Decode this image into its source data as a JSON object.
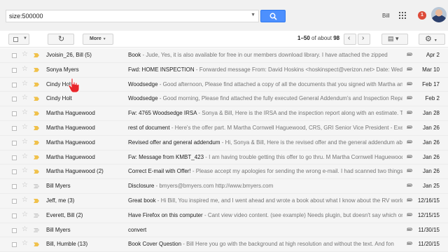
{
  "search": {
    "value": "size:500000"
  },
  "header": {
    "user_name": "Bill",
    "notification_count": "1"
  },
  "toolbar": {
    "more_label": "More",
    "pager": {
      "range": "1–50",
      "of_text": "of about",
      "total": "98"
    }
  },
  "icons": {
    "search": "search-icon",
    "apps": "apps-grid-icon",
    "refresh": "refresh-icon",
    "settings": "gear-icon",
    "star": "star-icon",
    "importance": "importance-marker-icon",
    "attachment": "paperclip-icon"
  },
  "colors": {
    "search_button": "#4d90fe",
    "notification": "#dd4b39",
    "important_marker": "#f0c14b"
  },
  "emails": [
    {
      "sender": "Jvoisin_26, Bill (5)",
      "subject": "Book",
      "snippet": " - Jude, Yes, it is also available for free in our members download library. I have attached the zipped",
      "date": "Apr 2",
      "important": true,
      "attachment": true
    },
    {
      "sender": "Sonya Myers",
      "subject": "Fwd: HOME INSPECTION",
      "snippet": " - Forwarded message From: David Hoskins <hoskinspect@verizon.net> Date: Wed",
      "date": "Mar 10",
      "important": true,
      "attachment": true
    },
    {
      "sender": "Cindy Holt",
      "subject": "Woodsedge",
      "snippet": " - Good afternoon, Please find attached a copy of all the documents that you signed with Martha and",
      "date": "Feb 17",
      "important": true,
      "attachment": true
    },
    {
      "sender": "Cindy Holt",
      "subject": "Woodsedge",
      "snippet": " - Good morning, Please find attached the fully executed General Addendum's and Inspection Repair",
      "date": "Feb 2",
      "important": true,
      "attachment": true
    },
    {
      "sender": "Martha Haguewood",
      "subject": "Fw: 4765 Woodsedge IRSA",
      "snippet": " - Sonya & Bill, Here is the IRSA and the inspection report along with an estimate. T",
      "date": "Jan 28",
      "important": true,
      "attachment": true
    },
    {
      "sender": "Martha Haguewood",
      "subject": "rest of document",
      "snippet": " - Here's the offer part. M Martha Cornwell Haguewood, CRS, GRI Senior Vice President - Exec",
      "date": "Jan 26",
      "important": true,
      "attachment": true
    },
    {
      "sender": "Martha Haguewood",
      "subject": "Revised offer and general addendum",
      "snippet": " - Hi, Sonya & Bill, Here is the revised offer and the general addendum abou",
      "date": "Jan 26",
      "important": true,
      "attachment": true
    },
    {
      "sender": "Martha Haguewood",
      "subject": "Fw: Message from KMBT_423",
      "snippet": " - I am having trouble getting this offer to go thru. M Martha Cornwell Haguewood",
      "date": "Jan 26",
      "important": true,
      "attachment": true
    },
    {
      "sender": "Martha Haguewood (2)",
      "subject": "Correct E-mail with Offer!",
      "snippet": " - Please accept my apologies for sending the wrong e-mail. I had scanned two things,",
      "date": "Jan 26",
      "important": true,
      "attachment": true
    },
    {
      "sender": "Bill Myers",
      "subject": "Disclosure",
      "snippet": " - bmyers@bmyers.com http://www.bmyers.com",
      "date": "Jan 25",
      "important": false,
      "attachment": true
    },
    {
      "sender": "Jeff, me (3)",
      "subject": "Great book",
      "snippet": " - Hi Bill, You inspired me, and I went ahead and wrote a book about what I know about the RV world,",
      "date": "12/16/15",
      "important": true,
      "attachment": true
    },
    {
      "sender": "Everett, Bill (2)",
      "subject": "Have Firefox on this computer",
      "snippet": " - Cant view video content. (see example) Needs plugin, but doesn't say which one.",
      "date": "12/15/15",
      "important": false,
      "attachment": true
    },
    {
      "sender": "Bill Myers",
      "subject": "convert",
      "snippet": "",
      "date": "11/30/15",
      "important": false,
      "attachment": true
    },
    {
      "sender": "Bill, Humble (13)",
      "subject": "Book Cover Question",
      "snippet": " - Bill Here you go with the background at high resolution and without the text. And fon",
      "date": "11/20/15",
      "important": true,
      "attachment": true
    }
  ]
}
